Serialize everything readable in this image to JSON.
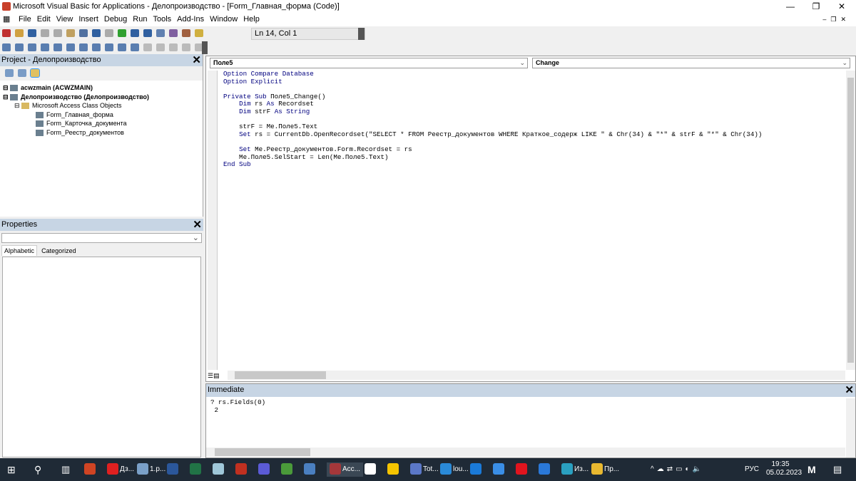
{
  "window": {
    "title": "Microsoft Visual Basic for Applications - Делопроизводство - [Form_Главная_форма (Code)]"
  },
  "menu": [
    "File",
    "Edit",
    "View",
    "Insert",
    "Debug",
    "Run",
    "Tools",
    "Add-Ins",
    "Window",
    "Help"
  ],
  "toolbar": {
    "position": "Ln 14, Col 1"
  },
  "project": {
    "title": "Project - Делопроизводство",
    "items": [
      {
        "label": "acwzmain (ACWZMAIN)",
        "level": 0,
        "bold": true
      },
      {
        "label": "Делопроизводство (Делопроизводство)",
        "level": 0,
        "bold": true
      },
      {
        "label": "Microsoft Access Class Objects",
        "level": 1,
        "bold": false
      },
      {
        "label": "Form_Главная_форма",
        "level": 2,
        "bold": false
      },
      {
        "label": "Form_Карточка_документа",
        "level": 2,
        "bold": false
      },
      {
        "label": "Form_Реестр_документов",
        "level": 2,
        "bold": false
      }
    ]
  },
  "properties": {
    "title": "Properties",
    "tabs": [
      "Alphabetic",
      "Categorized"
    ]
  },
  "code": {
    "object": "Поле5",
    "procedure": "Change",
    "lines": [
      [
        [
          "kw",
          "Option Compare Database"
        ]
      ],
      [
        [
          "kw",
          "Option Explicit"
        ]
      ],
      [],
      [
        [
          "kw",
          "Private Sub "
        ],
        [
          "t",
          "Поле5_Change()"
        ]
      ],
      [
        [
          "t",
          "    "
        ],
        [
          "kw",
          "Dim "
        ],
        [
          "t",
          "rs "
        ],
        [
          "kw",
          "As "
        ],
        [
          "t",
          "Recordset"
        ]
      ],
      [
        [
          "t",
          "    "
        ],
        [
          "kw",
          "Dim "
        ],
        [
          "t",
          "strF "
        ],
        [
          "kw",
          "As String"
        ]
      ],
      [],
      [
        [
          "t",
          "    strF = Me.Поле5.Text"
        ]
      ],
      [
        [
          "t",
          "    "
        ],
        [
          "kw",
          "Set "
        ],
        [
          "t",
          "rs = CurrentDb.OpenRecordset(\"SELECT * FROM Реестр_документов WHERE Краткое_содерж LIKE \" & Chr(34) & \"*\" & strF & \"*\" & Chr(34))"
        ]
      ],
      [],
      [
        [
          "t",
          "    "
        ],
        [
          "kw",
          "Set "
        ],
        [
          "t",
          "Me.Реестр_документов.Form.Recordset = rs"
        ]
      ],
      [
        [
          "t",
          "    Me.Поле5.SelStart = Len(Me.Поле5.Text)"
        ]
      ],
      [
        [
          "kw",
          "End Sub"
        ]
      ]
    ]
  },
  "immediate": {
    "title": "Immediate",
    "lines": [
      "? rs.Fields(0)",
      " 2"
    ]
  },
  "taskbar": {
    "apps": [
      {
        "name": "powerpoint",
        "label": "",
        "color": "#d04423"
      },
      {
        "name": "yandex",
        "label": "Дз...",
        "color": "#e02020"
      },
      {
        "name": "paint",
        "label": "1.p...",
        "color": "#7aa0c8"
      },
      {
        "name": "word",
        "label": "",
        "color": "#2b579a"
      },
      {
        "name": "excel",
        "label": "",
        "color": "#217346"
      },
      {
        "name": "notes",
        "label": "",
        "color": "#9fc7d9"
      },
      {
        "name": "apps",
        "label": "",
        "color": "#c03020"
      },
      {
        "name": "media",
        "label": "",
        "color": "#5b5bd6"
      },
      {
        "name": "editor",
        "label": "",
        "color": "#4a9a3a"
      },
      {
        "name": "pdf",
        "label": "",
        "color": "#4a7fc0"
      },
      {
        "name": "access",
        "label": "Acc...",
        "color": "#a4373a"
      },
      {
        "name": "pen",
        "label": "",
        "color": "#ffffff"
      },
      {
        "name": "sticky",
        "label": "",
        "color": "#f5c400"
      },
      {
        "name": "totalcmd",
        "label": "Tot...",
        "color": "#5b78c8"
      },
      {
        "name": "vscode",
        "label": "lou...",
        "color": "#2a8ad8"
      },
      {
        "name": "mail",
        "label": "",
        "color": "#1a7ad8"
      },
      {
        "name": "todo",
        "label": "",
        "color": "#3a8ee6"
      },
      {
        "name": "opera",
        "label": "",
        "color": "#e0141e"
      },
      {
        "name": "calendar",
        "label": "",
        "color": "#2a78d8"
      },
      {
        "name": "edge",
        "label": "Из...",
        "color": "#2aa0c0"
      },
      {
        "name": "explorer",
        "label": "Пр...",
        "color": "#e8b830"
      }
    ],
    "lang": "РУС",
    "time": "19:35",
    "date": "05.02.2023"
  }
}
